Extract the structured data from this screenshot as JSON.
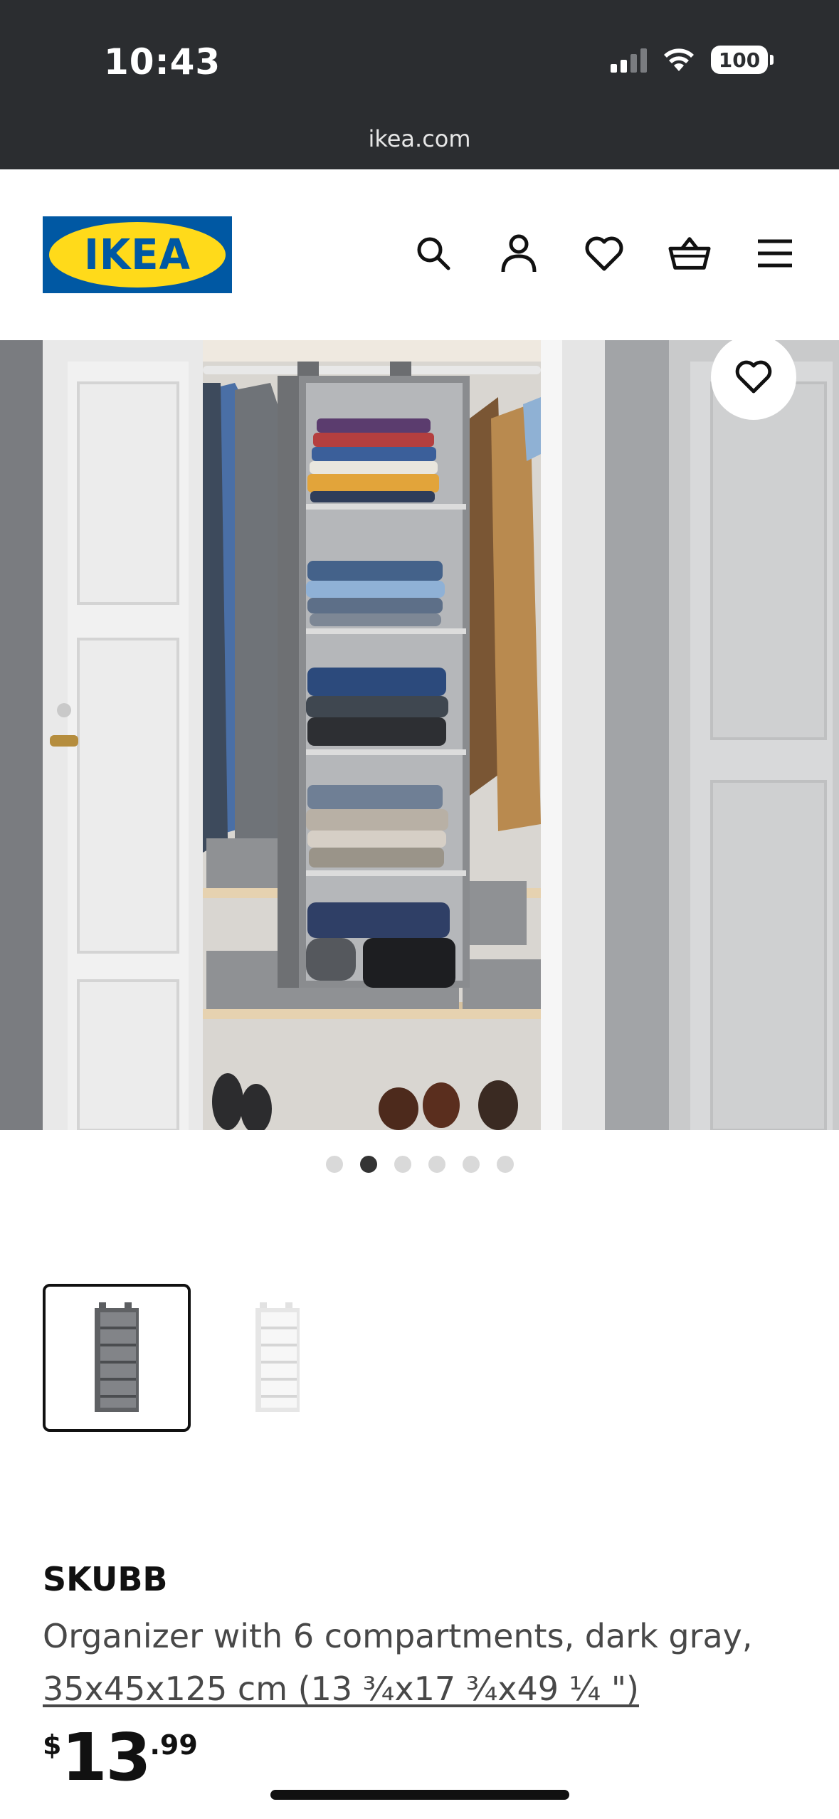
{
  "status_bar": {
    "time": "10:43",
    "battery": "100"
  },
  "browser": {
    "url": "ikea.com"
  },
  "header": {
    "logo_text": "IKEA",
    "icons": [
      "search-icon",
      "account-icon",
      "heart-icon",
      "basket-icon",
      "menu-icon"
    ]
  },
  "gallery": {
    "image_count": 6,
    "active_index": 1
  },
  "variants": [
    {
      "name": "dark gray",
      "selected": true
    },
    {
      "name": "white",
      "selected": false
    }
  ],
  "product": {
    "name": "SKUBB",
    "description": "Organizer with 6 compartments, dark gray,",
    "size": "35x45x125 cm (13 ¾x17 ¾x49 ¼ \")",
    "price_currency": "$",
    "price_integer": "13",
    "price_decimal": ".99"
  },
  "colors": {
    "ikea_blue": "#0058a3",
    "ikea_yellow": "#ffda1a",
    "status_bar": "#2b2d30"
  }
}
